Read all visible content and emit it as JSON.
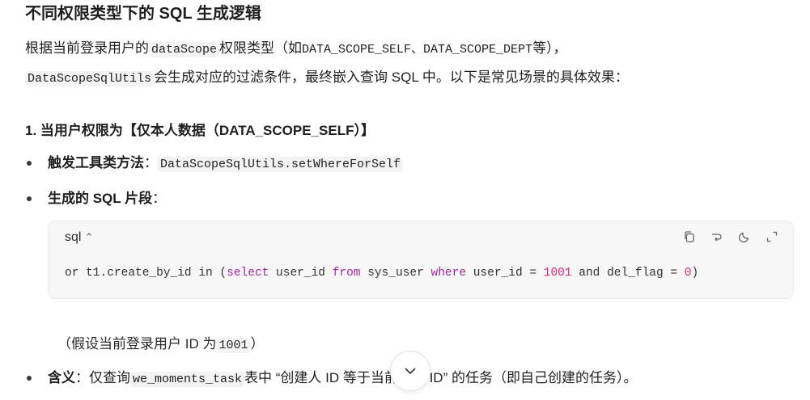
{
  "heading": "不同权限类型下的 SQL 生成逻辑",
  "intro": {
    "line1_pre": "根据当前登录用户的",
    "line1_code1": "dataScope",
    "line1_mid": "权限类型（如",
    "line1_code2": "DATA_SCOPE_SELF、DATA_SCOPE_DEPT",
    "line1_post": "等），",
    "line2_code": "DataScopeSqlUtils",
    "line2_post": "会生成对应的过滤条件，最终嵌入查询 SQL 中。以下是常见场景的具体效果："
  },
  "section1": {
    "title": "1. 当用户权限为【仅本人数据（DATA_SCOPE_SELF）】",
    "item1_label": "触发工具类方法",
    "item1_sep": "：",
    "item1_code": "DataScopeSqlUtils.setWhereForSelf",
    "item2_label": "生成的 SQL 片段",
    "item2_sep": "：",
    "code_lang": "sql",
    "code": {
      "t1": "or t1.create_by_id in (",
      "k1": "select",
      "t2": " user_id ",
      "k2": "from",
      "t3": " sys_user ",
      "k3": "where",
      "t4": " user_id = ",
      "n1": "1001",
      "t5": " and del_flag = ",
      "n2": "0",
      "t6": ")"
    },
    "note_pre": "（假设当前登录用户 ID 为",
    "note_code": "1001",
    "note_post": "）",
    "item3_label": "含义",
    "item3_sep": "：",
    "item3_pre": "仅查询",
    "item3_code": "we_moments_task",
    "item3_post": "表中 “创建人 ID 等于当前用户 ID” 的任务（即自己创建的任务）。"
  },
  "icons": [
    "copy-icon",
    "wrap-icon",
    "theme-icon",
    "expand-icon",
    "chevron-down-icon"
  ]
}
